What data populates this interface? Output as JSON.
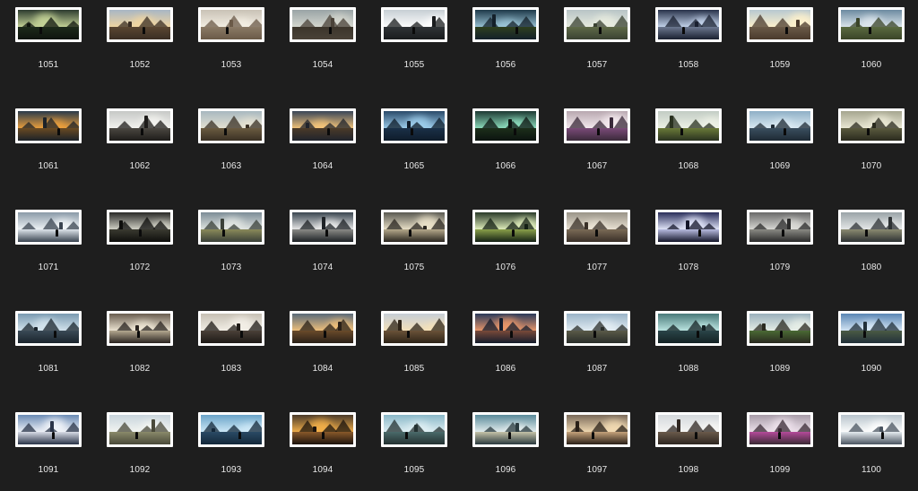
{
  "gallery": {
    "items": [
      {
        "label": "1051",
        "palette": {
          "sky": "#2c3a2e",
          "ground": "#1d2a1a",
          "glow": "#c9d89a",
          "accent": "#0f140e"
        }
      },
      {
        "label": "1052",
        "palette": {
          "sky": "#a8b6c4",
          "ground": "#5a4632",
          "glow": "#f2d6a0",
          "accent": "#3a2e24"
        }
      },
      {
        "label": "1053",
        "palette": {
          "sky": "#c9c2b6",
          "ground": "#8a7a66",
          "glow": "#f4efe4",
          "accent": "#6b5a48"
        }
      },
      {
        "label": "1054",
        "palette": {
          "sky": "#9aa4a6",
          "ground": "#3b342a",
          "glow": "#d6d8cf",
          "accent": "#4a4238"
        }
      },
      {
        "label": "1055",
        "palette": {
          "sky": "#c7cfd4",
          "ground": "#2f3336",
          "glow": "#ffffff",
          "accent": "#1a1c1e"
        }
      },
      {
        "label": "1056",
        "palette": {
          "sky": "#1f3a4a",
          "ground": "#2e3f1e",
          "glow": "#9cc6d8",
          "accent": "#14202a"
        }
      },
      {
        "label": "1057",
        "palette": {
          "sky": "#b8c4c6",
          "ground": "#5f6a48",
          "glow": "#e8ecdf",
          "accent": "#3a4232"
        }
      },
      {
        "label": "1058",
        "palette": {
          "sky": "#28324a",
          "ground": "#6c7890",
          "glow": "#c8d8f0",
          "accent": "#1a2030"
        }
      },
      {
        "label": "1059",
        "palette": {
          "sky": "#b8c8d0",
          "ground": "#6a5a48",
          "glow": "#fff2cc",
          "accent": "#4a3a2c"
        }
      },
      {
        "label": "1060",
        "palette": {
          "sky": "#6c8aa0",
          "ground": "#5a6a40",
          "glow": "#dfe8ee",
          "accent": "#3a4428"
        }
      },
      {
        "label": "1061",
        "palette": {
          "sky": "#2a3a4a",
          "ground": "#6a4a22",
          "glow": "#f0a23c",
          "accent": "#1c2228"
        }
      },
      {
        "label": "1062",
        "palette": {
          "sky": "#c6c8c6",
          "ground": "#4a4640",
          "glow": "#f4f4f0",
          "accent": "#1e1c1a"
        }
      },
      {
        "label": "1063",
        "palette": {
          "sky": "#a8b8c0",
          "ground": "#6a5a40",
          "glow": "#e6e2d2",
          "accent": "#3a3024"
        }
      },
      {
        "label": "1064",
        "palette": {
          "sky": "#3a4658",
          "ground": "#4a3a28",
          "glow": "#f6c67a",
          "accent": "#20242c"
        }
      },
      {
        "label": "1065",
        "palette": {
          "sky": "#2a4a6a",
          "ground": "#1a3048",
          "glow": "#9fd0ee",
          "accent": "#0f1c2a"
        }
      },
      {
        "label": "1066",
        "palette": {
          "sky": "#1e3a34",
          "ground": "#1c2e1a",
          "glow": "#8fe0c0",
          "accent": "#0c1410"
        }
      },
      {
        "label": "1067",
        "palette": {
          "sky": "#b8a8b0",
          "ground": "#7a4a78",
          "glow": "#f6ecf0",
          "accent": "#3a2a3a"
        }
      },
      {
        "label": "1068",
        "palette": {
          "sky": "#c2ccc4",
          "ground": "#6a7a38",
          "glow": "#eef2e6",
          "accent": "#2a3220"
        }
      },
      {
        "label": "1069",
        "palette": {
          "sky": "#8fb0c6",
          "ground": "#3a4e5e",
          "glow": "#dcebf4",
          "accent": "#1e2a34"
        }
      },
      {
        "label": "1070",
        "palette": {
          "sky": "#a6a690",
          "ground": "#5a5a3e",
          "glow": "#ecead6",
          "accent": "#2a2a1e"
        }
      },
      {
        "label": "1071",
        "palette": {
          "sky": "#8a9aa8",
          "ground": "#dde4ea",
          "glow": "#f2f6f8",
          "accent": "#3a4450"
        }
      },
      {
        "label": "1072",
        "palette": {
          "sky": "#2a2a28",
          "ground": "#3a3a30",
          "glow": "#d8d8cc",
          "accent": "#0e0e0c"
        }
      },
      {
        "label": "1073",
        "palette": {
          "sky": "#7c8c96",
          "ground": "#8a8a5a",
          "glow": "#e4e8e4",
          "accent": "#3a4038"
        }
      },
      {
        "label": "1074",
        "palette": {
          "sky": "#3a4650",
          "ground": "#8a8a86",
          "glow": "#eeeeee",
          "accent": "#1e2226"
        }
      },
      {
        "label": "1075",
        "palette": {
          "sky": "#5a5a52",
          "ground": "#b4a88a",
          "glow": "#efe6cc",
          "accent": "#2a2620"
        }
      },
      {
        "label": "1076",
        "palette": {
          "sky": "#2a3a2a",
          "ground": "#8aa04a",
          "glow": "#e6f4c0",
          "accent": "#142014"
        }
      },
      {
        "label": "1077",
        "palette": {
          "sky": "#9a9488",
          "ground": "#7a6a56",
          "glow": "#ece4d6",
          "accent": "#3a3028"
        }
      },
      {
        "label": "1078",
        "palette": {
          "sky": "#2a2e5a",
          "ground": "#b8bce0",
          "glow": "#e8ecff",
          "accent": "#14162a"
        }
      },
      {
        "label": "1079",
        "palette": {
          "sky": "#6a6a6a",
          "ground": "#8a8a84",
          "glow": "#dcdcd8",
          "accent": "#2a2a2a"
        }
      },
      {
        "label": "1080",
        "palette": {
          "sky": "#9aa4a8",
          "ground": "#8a8a70",
          "glow": "#e8eaea",
          "accent": "#2e3234"
        }
      },
      {
        "label": "1081",
        "palette": {
          "sky": "#7a9ab0",
          "ground": "#3a4a56",
          "glow": "#d6e6ef",
          "accent": "#1a242c"
        }
      },
      {
        "label": "1082",
        "palette": {
          "sky": "#6a5e50",
          "ground": "#b4a890",
          "glow": "#f2ead8",
          "accent": "#2a2420"
        }
      },
      {
        "label": "1083",
        "palette": {
          "sky": "#c6c0b4",
          "ground": "#4a4038",
          "glow": "#f4f0e8",
          "accent": "#1e1a16"
        }
      },
      {
        "label": "1084",
        "palette": {
          "sky": "#5a6a7a",
          "ground": "#6a4a2a",
          "glow": "#f4c27a",
          "accent": "#2a2018"
        }
      },
      {
        "label": "1085",
        "palette": {
          "sky": "#c6cdd6",
          "ground": "#6a5238",
          "glow": "#f6e2b8",
          "accent": "#2e2418"
        }
      },
      {
        "label": "1086",
        "palette": {
          "sky": "#2a3a5a",
          "ground": "#7a4a3a",
          "glow": "#f09a6a",
          "accent": "#141c2c"
        }
      },
      {
        "label": "1087",
        "palette": {
          "sky": "#9ab4c8",
          "ground": "#5a5a48",
          "glow": "#e4eef4",
          "accent": "#2a2e2a"
        }
      },
      {
        "label": "1088",
        "palette": {
          "sky": "#4a7a7a",
          "ground": "#2a4448",
          "glow": "#bfe8e4",
          "accent": "#142224"
        }
      },
      {
        "label": "1089",
        "palette": {
          "sky": "#9ab0bc",
          "ground": "#4a6a34",
          "glow": "#e8f0e8",
          "accent": "#2a2a20"
        }
      },
      {
        "label": "1090",
        "palette": {
          "sky": "#5a86b4",
          "ground": "#4a5a44",
          "glow": "#d8e8f6",
          "accent": "#22303a"
        }
      },
      {
        "label": "1091",
        "palette": {
          "sky": "#6a8ab4",
          "ground": "#d8dce6",
          "glow": "#f4f6fa",
          "accent": "#2a3448"
        }
      },
      {
        "label": "1092",
        "palette": {
          "sky": "#c8d4dc",
          "ground": "#8a8a6a",
          "glow": "#f4f6f2",
          "accent": "#4a4a3a"
        }
      },
      {
        "label": "1093",
        "palette": {
          "sky": "#6aa4c8",
          "ground": "#2a4a64",
          "glow": "#d0eaf8",
          "accent": "#14283a"
        }
      },
      {
        "label": "1094",
        "palette": {
          "sky": "#4a3a2a",
          "ground": "#8a5a2a",
          "glow": "#f6b24a",
          "accent": "#1c140e"
        }
      },
      {
        "label": "1095",
        "palette": {
          "sky": "#8ab8c8",
          "ground": "#4a6a6a",
          "glow": "#e0f0f4",
          "accent": "#243232"
        }
      },
      {
        "label": "1096",
        "palette": {
          "sky": "#5a8a9a",
          "ground": "#c4c2a8",
          "glow": "#e8f0f0",
          "accent": "#2a3a3e"
        }
      },
      {
        "label": "1097",
        "palette": {
          "sky": "#7a6a5a",
          "ground": "#c4a27a",
          "glow": "#f4dcb4",
          "accent": "#2a2018"
        }
      },
      {
        "label": "1098",
        "palette": {
          "sky": "#d4d8dc",
          "ground": "#6a5a4a",
          "glow": "#f6f6f4",
          "accent": "#2e2620"
        }
      },
      {
        "label": "1099",
        "palette": {
          "sky": "#a89ca8",
          "ground": "#b44a9a",
          "glow": "#f0e4ee",
          "accent": "#3a2a34"
        }
      },
      {
        "label": "1100",
        "palette": {
          "sky": "#b8c4cc",
          "ground": "#e6ecf0",
          "glow": "#ffffff",
          "accent": "#4a5460"
        }
      }
    ]
  }
}
